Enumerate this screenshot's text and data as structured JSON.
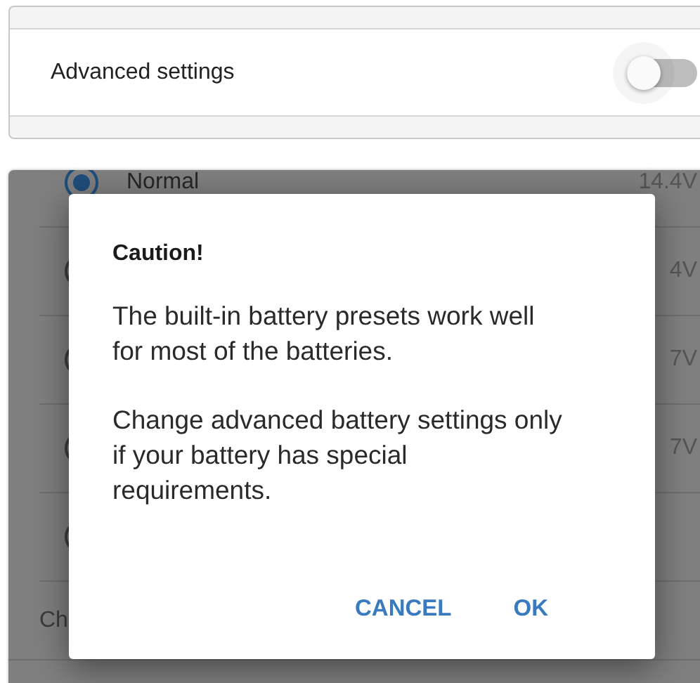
{
  "advanced_settings": {
    "label": "Advanced settings",
    "on": false
  },
  "presets": [
    {
      "label": "Normal",
      "value": "14.4V",
      "selected": true
    },
    {
      "value": "4V",
      "selected": false
    },
    {
      "value": "7V",
      "selected": false
    },
    {
      "value": "7V",
      "selected": false
    },
    {
      "selected": false
    }
  ],
  "charge_row": {
    "label": "Ch"
  },
  "dialog": {
    "title": "Caution!",
    "paragraphs": [
      "The built-in battery presets work well for most of the batteries.",
      "Change advanced battery settings only if your battery has special requirements."
    ],
    "buttons": [
      "CANCEL",
      "OK"
    ]
  }
}
